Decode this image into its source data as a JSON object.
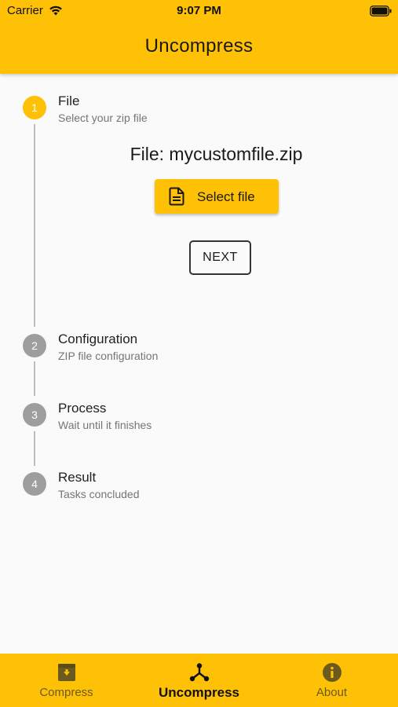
{
  "status_bar": {
    "carrier": "Carrier",
    "time": "9:07 PM",
    "icons": [
      "wifi-icon",
      "battery-icon"
    ]
  },
  "header": {
    "title": "Uncompress"
  },
  "colors": {
    "accent": "#fec105",
    "inactive_step": "#9e9e9e",
    "background": "#fafafa"
  },
  "stepper": {
    "steps": [
      {
        "number": "1",
        "title": "File",
        "subtitle": "Select your zip file",
        "state": "active"
      },
      {
        "number": "2",
        "title": "Configuration",
        "subtitle": "ZIP file configuration",
        "state": "inactive"
      },
      {
        "number": "3",
        "title": "Process",
        "subtitle": "Wait until it finishes",
        "state": "inactive"
      },
      {
        "number": "4",
        "title": "Result",
        "subtitle": "Tasks concluded",
        "state": "inactive"
      }
    ]
  },
  "file_step": {
    "file_label": "File: mycustomfile.zip",
    "select_button_label": "Select file",
    "select_button_icon": "file-document-icon",
    "next_button_label": "NEXT"
  },
  "bottom_nav": {
    "items": [
      {
        "label": "Compress",
        "icon": "archive-icon",
        "active": false
      },
      {
        "label": "Uncompress",
        "icon": "hub-icon",
        "active": true
      },
      {
        "label": "About",
        "icon": "info-icon",
        "active": false
      }
    ]
  }
}
